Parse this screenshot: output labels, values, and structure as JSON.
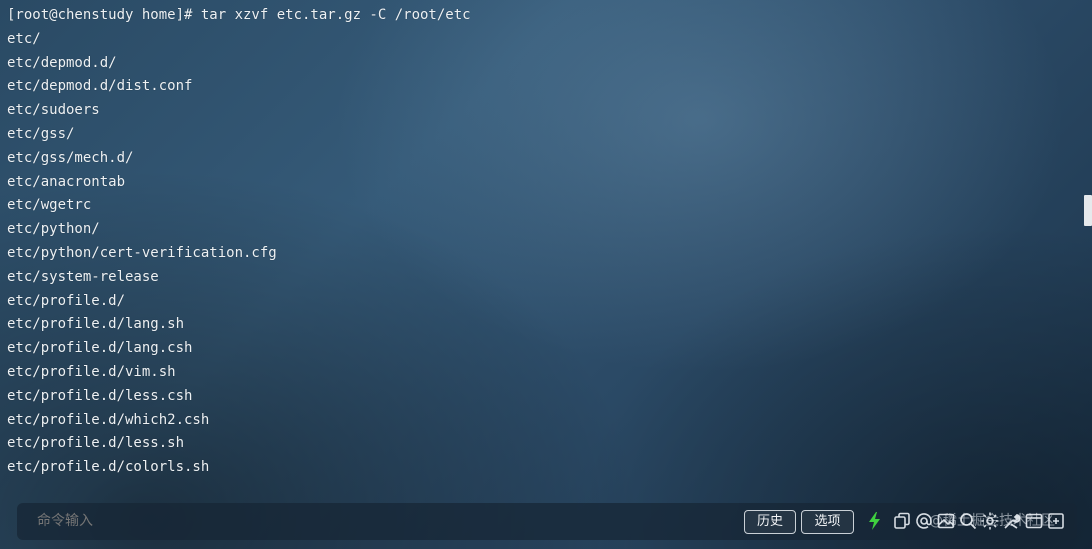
{
  "terminal": {
    "lines": [
      "[root@chenstudy home]# tar xzvf etc.tar.gz -C /root/etc",
      "etc/",
      "etc/depmod.d/",
      "etc/depmod.d/dist.conf",
      "etc/sudoers",
      "etc/gss/",
      "etc/gss/mech.d/",
      "etc/anacrontab",
      "etc/wgetrc",
      "etc/python/",
      "etc/python/cert-verification.cfg",
      "etc/system-release",
      "etc/profile.d/",
      "etc/profile.d/lang.sh",
      "etc/profile.d/lang.csh",
      "etc/profile.d/vim.sh",
      "etc/profile.d/less.csh",
      "etc/profile.d/which2.csh",
      "etc/profile.d/less.sh",
      "etc/profile.d/colorls.sh"
    ]
  },
  "command_bar": {
    "placeholder": "命令输入",
    "history_label": "历史",
    "options_label": "选项",
    "watermark": "@稀土掘金技术社区"
  },
  "colors": {
    "bolt": "#3fd13f",
    "text": "#edf1f4"
  },
  "icons": [
    "bolt-icon",
    "copy-icon",
    "at-icon",
    "image-icon",
    "search-icon",
    "gear-icon",
    "tools-icon",
    "window-icon",
    "expand-icon"
  ]
}
